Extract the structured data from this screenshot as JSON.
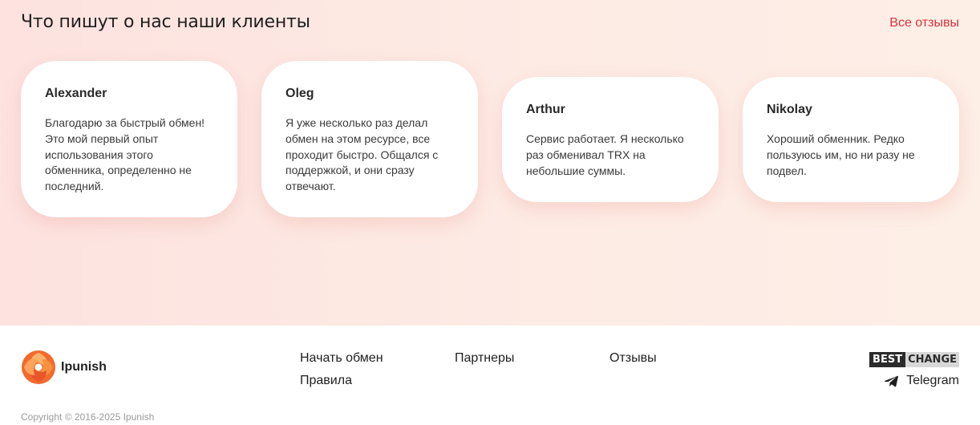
{
  "reviews": {
    "title": "Что пишут о нас наши клиенты",
    "all_link": "Все отзывы",
    "items": [
      {
        "name": "Alexander",
        "text": "Благодарю за быстрый обмен! Это мой первый опыт использования этого обменника, определенно не последний."
      },
      {
        "name": "Oleg",
        "text": "Я уже несколько раз делал обмен на этом ресурсе, все проходит быстро. Общался с поддержкой, и они сразу отвечают."
      },
      {
        "name": "Arthur",
        "text": "Сервис работает. Я несколько раз обменивал TRX на небольшие суммы."
      },
      {
        "name": "Nikolay",
        "text": "Хороший обменник. Редко пользуюсь им, но ни разу не подвел."
      }
    ]
  },
  "footer": {
    "brand": "Ipunish",
    "nav": [
      "Начать обмен",
      "Партнеры",
      "Отзывы",
      "Правила"
    ],
    "bestchange": {
      "best": "BEST",
      "change": "CHANGE"
    },
    "telegram": "Telegram",
    "telegram_icon": "paper-plane-icon",
    "copyright": "Copyright © 2016-2025 Ipunish"
  },
  "colors": {
    "accent": "#d6343f",
    "logo_orange": "#f26a2e"
  }
}
